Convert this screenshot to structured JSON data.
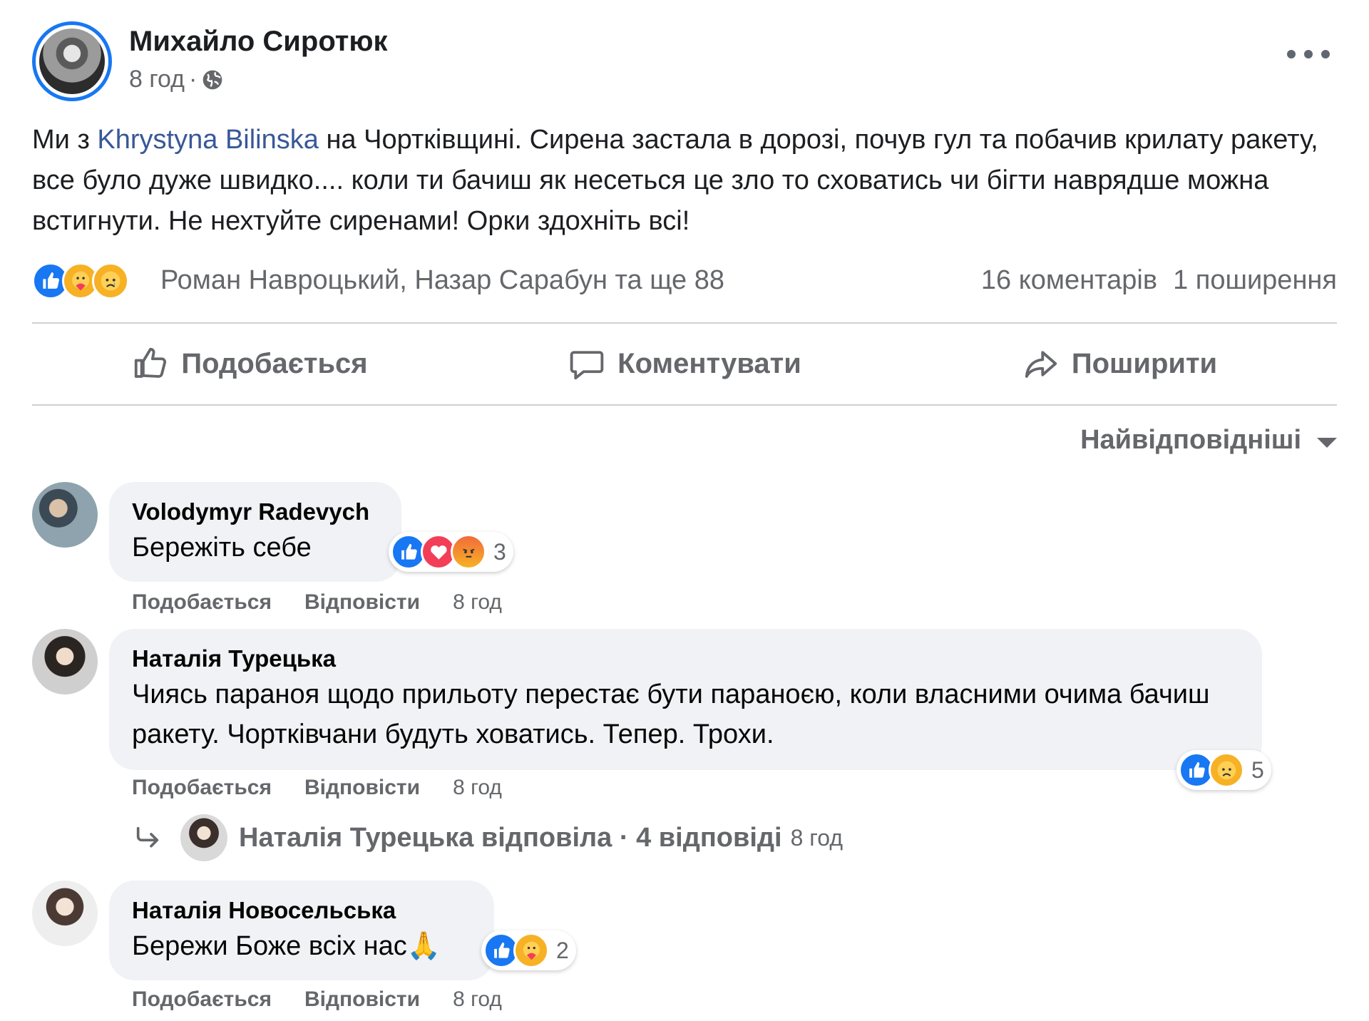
{
  "post": {
    "author": "Михайло Сиротюк",
    "time": "8 год",
    "separator": "·",
    "text_before": "Ми з ",
    "mention": "Khrystyna Bilinska",
    "text_after": "  на Чортківщині. Сирена застала в дорозі, почув гул та побачив крилату ракету, все було дуже швидко.... коли ти бачиш як несеться це зло то сховатись чи бігти наврядше можна встигнути. Не нехтуйте сиренами! Орки здохніть всі!",
    "reactors": "Роман Навроцький, Назар Сарабун та ще 88",
    "comments_count": "16 коментарів",
    "shares_count": "1 поширення"
  },
  "actions": {
    "like": "Подобається",
    "comment": "Коментувати",
    "share": "Поширити"
  },
  "sort_label": "Найвідповідніші",
  "comments": [
    {
      "name": "Volodymyr Radevych",
      "text": "Бережіть себе",
      "reaction_count": "3",
      "like": "Подобається",
      "reply": "Відповісти",
      "time": "8 год"
    },
    {
      "name": "Наталія Турецька",
      "text": "Чиясь параноя щодо прильоту перестає бути параноєю, коли власними очима бачиш ракету. Чортківчани будуть ховатись. Тепер. Трохи.",
      "reaction_count": "5",
      "like": "Подобається",
      "reply": "Відповісти",
      "time": "8 год"
    },
    {
      "name": "Наталія Новосельська",
      "text": "Бережи Боже всіх нас🙏",
      "reaction_count": "2",
      "like": "Подобається",
      "reply": "Відповісти",
      "time": "8 год"
    }
  ],
  "replies_summary": {
    "text": "Наталія Турецька відповіла · 4 відповіді",
    "time": "8 год"
  },
  "colors": {
    "accent": "#1877f2",
    "link": "#385898",
    "muted": "#65676b",
    "bubble": "#f0f2f5"
  }
}
